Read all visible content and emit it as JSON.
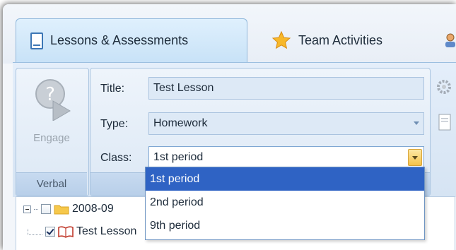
{
  "tabs": [
    {
      "label": "Lessons & Assessments",
      "icon": "document-icon",
      "active": true
    },
    {
      "label": "Team Activities",
      "icon": "star-icon",
      "active": false
    }
  ],
  "ribbon": {
    "verbal_group": {
      "button_label": "Engage",
      "group_label": "Verbal",
      "icon": "engage-play-icon"
    },
    "form": {
      "title_label": "Title:",
      "title_value": "Test Lesson",
      "type_label": "Type:",
      "type_value": "Homework",
      "class_label": "Class:",
      "class_value": "1st period"
    }
  },
  "class_dropdown": {
    "options": [
      "1st period",
      "2nd period",
      "9th period"
    ],
    "selected_index": 0
  },
  "tree": {
    "folder_label": "2008-09",
    "lesson_label": "Test Lesson"
  },
  "colors": {
    "accent": "#2f63c4",
    "ribbon_bg": "#dce8f5",
    "dropdown_button": "#f5c24a"
  }
}
